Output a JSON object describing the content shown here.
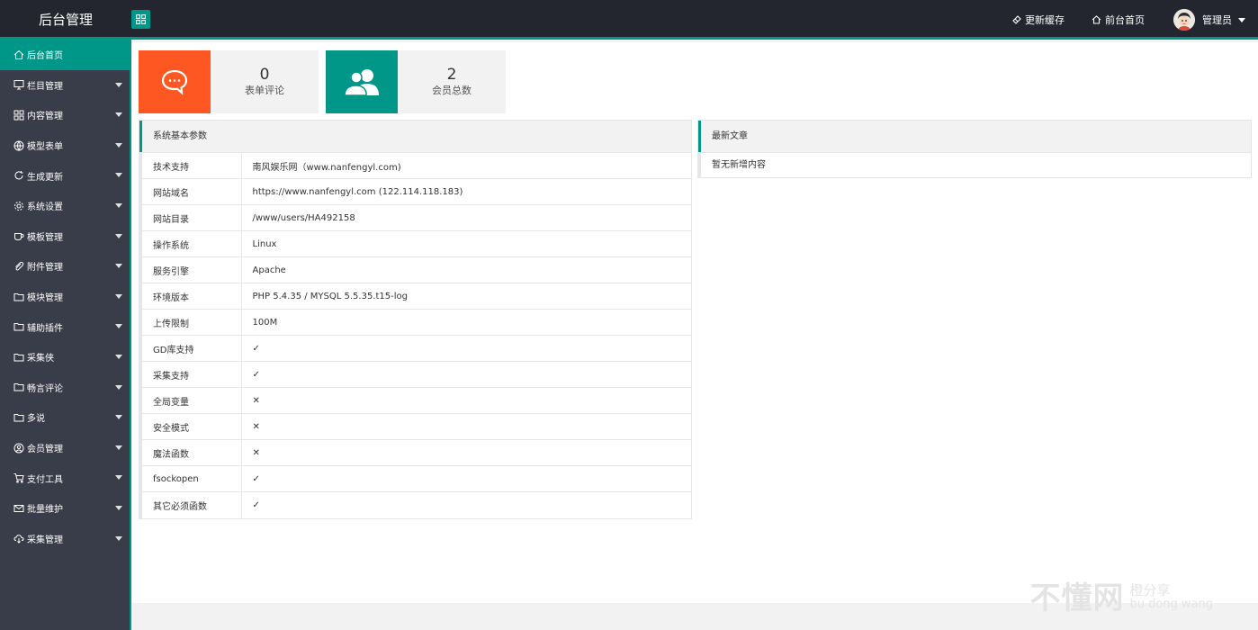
{
  "header": {
    "title": "后台管理",
    "links": [
      {
        "label": "更新缓存",
        "icon": "eraser-icon"
      },
      {
        "label": "前台首页",
        "icon": "home-icon"
      }
    ],
    "admin_label": "管理员"
  },
  "sidebar": {
    "items": [
      {
        "label": "后台首页",
        "icon": "home-icon"
      },
      {
        "label": "栏目管理",
        "icon": "monitor-icon"
      },
      {
        "label": "内容管理",
        "icon": "app-grid-icon"
      },
      {
        "label": "模型表单",
        "icon": "globe-icon"
      },
      {
        "label": "生成更新",
        "icon": "refresh-icon"
      },
      {
        "label": "系统设置",
        "icon": "gear-icon"
      },
      {
        "label": "模板管理",
        "icon": "cup-icon"
      },
      {
        "label": "附件管理",
        "icon": "paperclip-icon"
      },
      {
        "label": "模块管理",
        "icon": "folder-icon"
      },
      {
        "label": "辅助插件",
        "icon": "folder-icon"
      },
      {
        "label": "采集侠",
        "icon": "folder-icon"
      },
      {
        "label": "畅言评论",
        "icon": "folder-icon"
      },
      {
        "label": "多说",
        "icon": "folder-icon"
      },
      {
        "label": "会员管理",
        "icon": "user-circle-icon"
      },
      {
        "label": "支付工具",
        "icon": "cart-icon"
      },
      {
        "label": "批量维护",
        "icon": "mail-icon"
      },
      {
        "label": "采集管理",
        "icon": "cloud-icon"
      }
    ]
  },
  "stats": [
    {
      "value": "0",
      "label": "表单评论",
      "icon": "comment-icon",
      "color": "#ff5722"
    },
    {
      "value": "2",
      "label": "会员总数",
      "icon": "users-icon",
      "color": "#009688"
    }
  ],
  "system_panel": {
    "title": "系统基本参数",
    "rows": [
      {
        "key": "技术支持",
        "value": "南风娱乐网（www.nanfengyl.com)"
      },
      {
        "key": "网站域名",
        "value": "https://www.nanfengyl.com (122.114.118.183)"
      },
      {
        "key": "网站目录",
        "value": "/www/users/HA492158"
      },
      {
        "key": "操作系统",
        "value": "Linux"
      },
      {
        "key": "服务引擎",
        "value": "Apache"
      },
      {
        "key": "环境版本",
        "value": "PHP 5.4.35 / MYSQL 5.5.35.t15-log"
      },
      {
        "key": "上传限制",
        "value": "100M"
      },
      {
        "key": "GD库支持",
        "value": "✓"
      },
      {
        "key": "采集支持",
        "value": "✓"
      },
      {
        "key": "全局变量",
        "value": "✕"
      },
      {
        "key": "安全模式",
        "value": "✕"
      },
      {
        "key": "魔法函数",
        "value": "✕"
      },
      {
        "key": "fsockopen",
        "value": "✓"
      },
      {
        "key": "其它必须函数",
        "value": "✓"
      }
    ]
  },
  "articles_panel": {
    "title": "最新文章",
    "empty": "暂无新增内容"
  },
  "watermark": {
    "main": "不懂网",
    "sub": "橙分享",
    "pinyin": "bu dong wang"
  },
  "colors": {
    "accent": "#009688",
    "orange": "#ff5722",
    "header_bg": "#23262e",
    "sidebar_bg": "#393d49"
  }
}
